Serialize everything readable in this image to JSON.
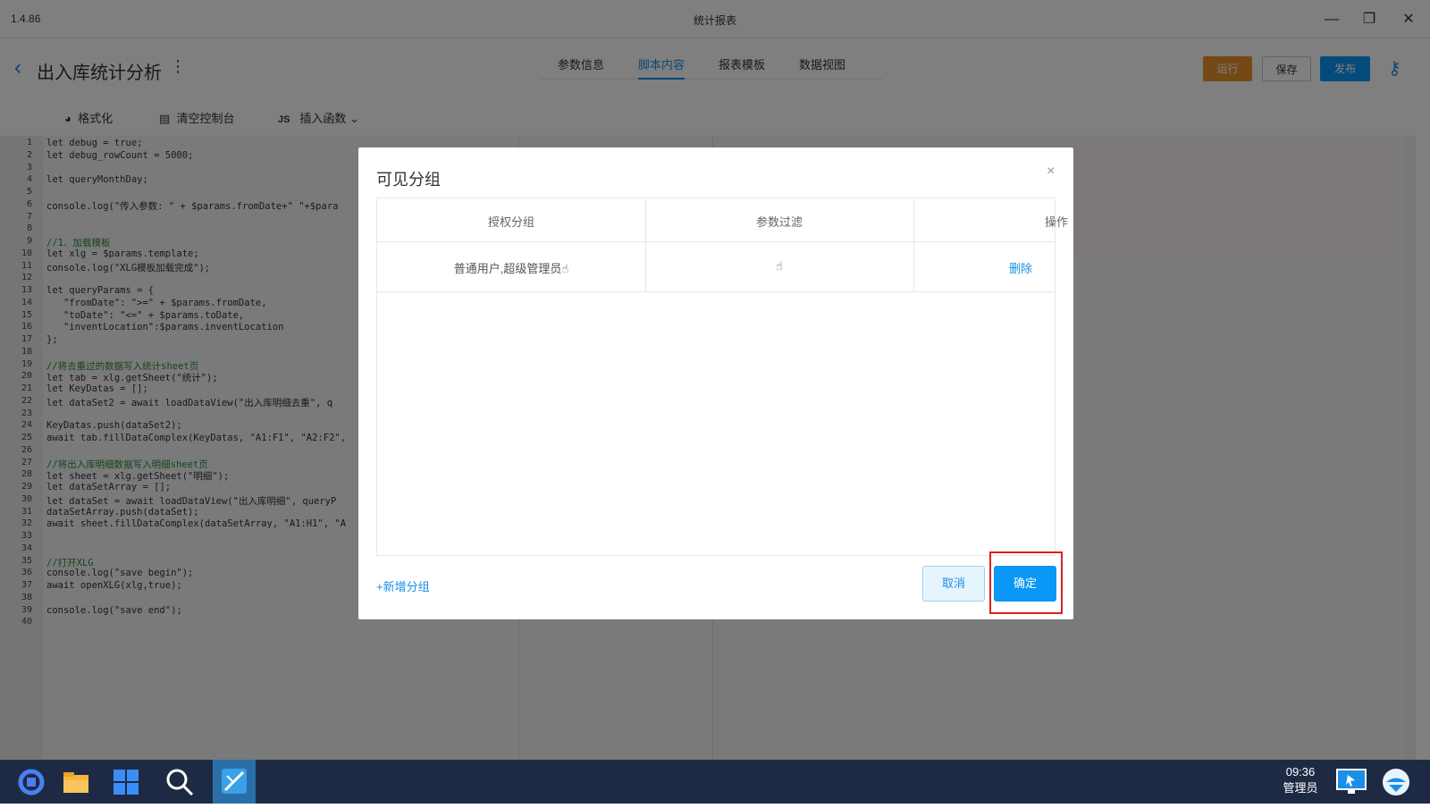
{
  "window": {
    "version": "1.4.86",
    "title": "统计报表",
    "minimize": "—",
    "restore": "❐",
    "close": "✕"
  },
  "header": {
    "back_icon": "‹",
    "title": "出入库统计分析",
    "more_icon": "⋮",
    "tabs": [
      {
        "label": "参数信息",
        "active": false
      },
      {
        "label": "脚本内容",
        "active": true
      },
      {
        "label": "报表模板",
        "active": false
      },
      {
        "label": "数据视图",
        "active": false
      }
    ],
    "actions": {
      "run": "运行",
      "save": "保存",
      "publish": "发布",
      "key_icon": "⚷"
    }
  },
  "toolbar": {
    "format": "格式化",
    "clear_console": "清空控制台",
    "js_badge": "JS",
    "insert_function": "插入函数"
  },
  "editor": {
    "lines": [
      "let debug = true;",
      "let debug_rowCount = 5000;",
      "",
      "let queryMonthDay;",
      "",
      "console.log(\"传入参数: \" + $params.fromDate+\" \"+$para",
      "",
      "",
      "//1、加载模板",
      "let xlg = $params.template;",
      "console.log(\"XLG模板加载完成\");",
      "",
      "let queryParams = {",
      "   \"fromDate\": \">=\" + $params.fromDate,",
      "   \"toDate\": \"<=\" + $params.toDate,",
      "   \"inventLocation\":$params.inventLocation",
      "};",
      "",
      "//将去重过的数据写入统计sheet页",
      "let tab = xlg.getSheet(\"统计\");",
      "let KeyDatas = [];",
      "let dataSet2 = await loadDataView(\"出入库明细去重\", q",
      "",
      "KeyDatas.push(dataSet2);",
      "await tab.fillDataComplex(KeyDatas, \"A1:F1\", \"A2:F2\",",
      "",
      "//将出入库明细数据写入明细sheet页",
      "let sheet = xlg.getSheet(\"明细\");",
      "let dataSetArray = [];",
      "let dataSet = await loadDataView(\"出入库明细\", queryP",
      "dataSetArray.push(dataSet);",
      "await sheet.fillDataComplex(dataSetArray, \"A1:H1\", \"A",
      "",
      "",
      "//打开XLG",
      "console.log(\"save begin\");",
      "await openXLG(xlg,true);",
      "",
      "console.log(\"save end\");",
      ""
    ]
  },
  "dialog": {
    "title": "可见分组",
    "close_icon": "×",
    "columns": [
      "授权分组",
      "参数过滤",
      "操作"
    ],
    "rows": [
      {
        "groups": "普通用户,超级管理员",
        "filter": "",
        "action": "删除"
      }
    ],
    "hand_icon": "☝",
    "add_group": "+新增分组",
    "cancel": "取消",
    "confirm": "确定"
  },
  "taskbar": {
    "time": "09:36",
    "user": "管理员"
  }
}
